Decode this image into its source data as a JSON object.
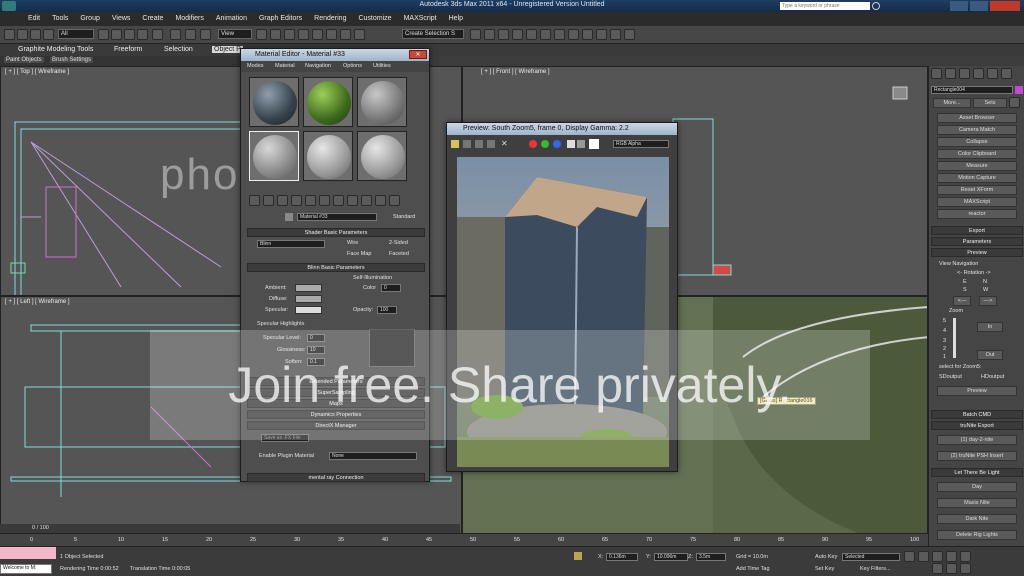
{
  "app": {
    "title": "Autodesk 3ds Max 2011 x64  -  Unregistered Version   Untitled",
    "search_placeholder": "Type a keyword or phrase"
  },
  "menu": [
    "Edit",
    "Tools",
    "Group",
    "Views",
    "Create",
    "Modifiers",
    "Animation",
    "Graph Editors",
    "Rendering",
    "Customize",
    "MAXScript",
    "Help"
  ],
  "toolbar": {
    "filter_value": "All",
    "view_value": "View",
    "selection_set_placeholder": "Create Selection S"
  },
  "ribbon": {
    "tabs": [
      "Graphite Modeling Tools",
      "Freeform",
      "Selection",
      "Object P"
    ],
    "subtabs": [
      "Paint Objects",
      "Brush Settings"
    ]
  },
  "viewports": {
    "top": "[ + ] [ Top ] [ Wireframe ]",
    "front": "[ + ] [ Front ] [ Wireframe ]",
    "left": "[ + ] [ Left ] [ Wireframe ]",
    "tooltip": "[Glass] Rectangle016"
  },
  "material_editor": {
    "title": "Material Editor - Material #33",
    "menu": [
      "Modes",
      "Material",
      "Navigation",
      "Options",
      "Utilities"
    ],
    "material_name": "Material #33",
    "material_type": "Standard",
    "shader_header": "Shader Basic Parameters",
    "shader_value": "Blinn",
    "shader_checks": [
      "Wire",
      "2-Sided",
      "Face Map",
      "Faceted"
    ],
    "blinn_header": "Blinn Basic Parameters",
    "self_illum": "Self-Illumination",
    "color_label": "Color",
    "color_value": "0",
    "ambient": "Ambient:",
    "diffuse": "Diffuse:",
    "specular": "Specular:",
    "opacity": "Opacity:",
    "opacity_value": "100",
    "spec_highlights": "Specular Highlights",
    "spec_level": "Specular Level:",
    "spec_level_value": "0",
    "glossiness": "Glossiness:",
    "glossiness_value": "10",
    "soften": "Soften:",
    "soften_value": "0.1",
    "rollouts": [
      "Extended Parameters",
      "SuperSampling",
      "Maps",
      "Dynamics Properties",
      "DirectX Manager"
    ],
    "save_fx": "Save as .FX File",
    "enable_plugin": "Enable Plugin Material",
    "plugin_value": "None",
    "mental_ray": "mental ray Connection"
  },
  "preview": {
    "title": "Preview: South Zoom5, frame 0, Display Gamma: 2.2",
    "channel": "RGB Alpha"
  },
  "command_panel": {
    "object_name": "Rectangle004",
    "more": "More...",
    "sets": "Sets",
    "utilities": [
      "Asset Browser",
      "Camera Match",
      "Collapse",
      "Color Clipboard",
      "Measure",
      "Motion Capture",
      "Reset XForm",
      "MAXScript",
      "reactor"
    ],
    "rollouts": [
      "Export",
      "Parameters",
      "Preview"
    ],
    "view_nav": "View Navigation",
    "rotation": "<- Rotation ->",
    "dirs": [
      "E",
      "N",
      "S",
      "W"
    ],
    "zoom": "Zoom",
    "zoom_levels": [
      "5",
      "4",
      "3",
      "2",
      "1"
    ],
    "in": "In",
    "out": "Out",
    "select_for": "select for Zoom5:",
    "sd_output": "SDoutput",
    "hd_output": "HDoutput",
    "preview_btn": "Preview",
    "batch": "Batch CMD",
    "trunite_export": "truNite Export",
    "day_nite": "(1) day-2-nite",
    "psh_insert": "(2) truNite PSH Insert",
    "let_there": "Let There Be Light",
    "lights": [
      "Day",
      "Maxis Nite",
      "Dark Nite",
      "Delete Rig Lights"
    ]
  },
  "status": {
    "frame": "0 / 100",
    "ticks": [
      "0",
      "5",
      "10",
      "15",
      "20",
      "25",
      "30",
      "35",
      "40",
      "45",
      "50",
      "55",
      "60",
      "65",
      "70",
      "75",
      "80",
      "85",
      "90",
      "95",
      "100"
    ],
    "welcome": "Welcome to M:",
    "selected_count": "1 Object Selected",
    "rendering_time": "Rendering Time  0:00:52",
    "translation_time": "Translation Time  0:00:05",
    "x": "0.136m",
    "y": "10.096m",
    "z": "3.5m",
    "grid": "Grid = 10.0m",
    "add_time_tag": "Add Time Tag",
    "auto_key": "Auto Key",
    "set_key": "Set Key",
    "selected": "Selected",
    "key_filters": "Key Filters..."
  },
  "watermark": {
    "logo": "photobucket",
    "text": "Join free. Share privately."
  }
}
